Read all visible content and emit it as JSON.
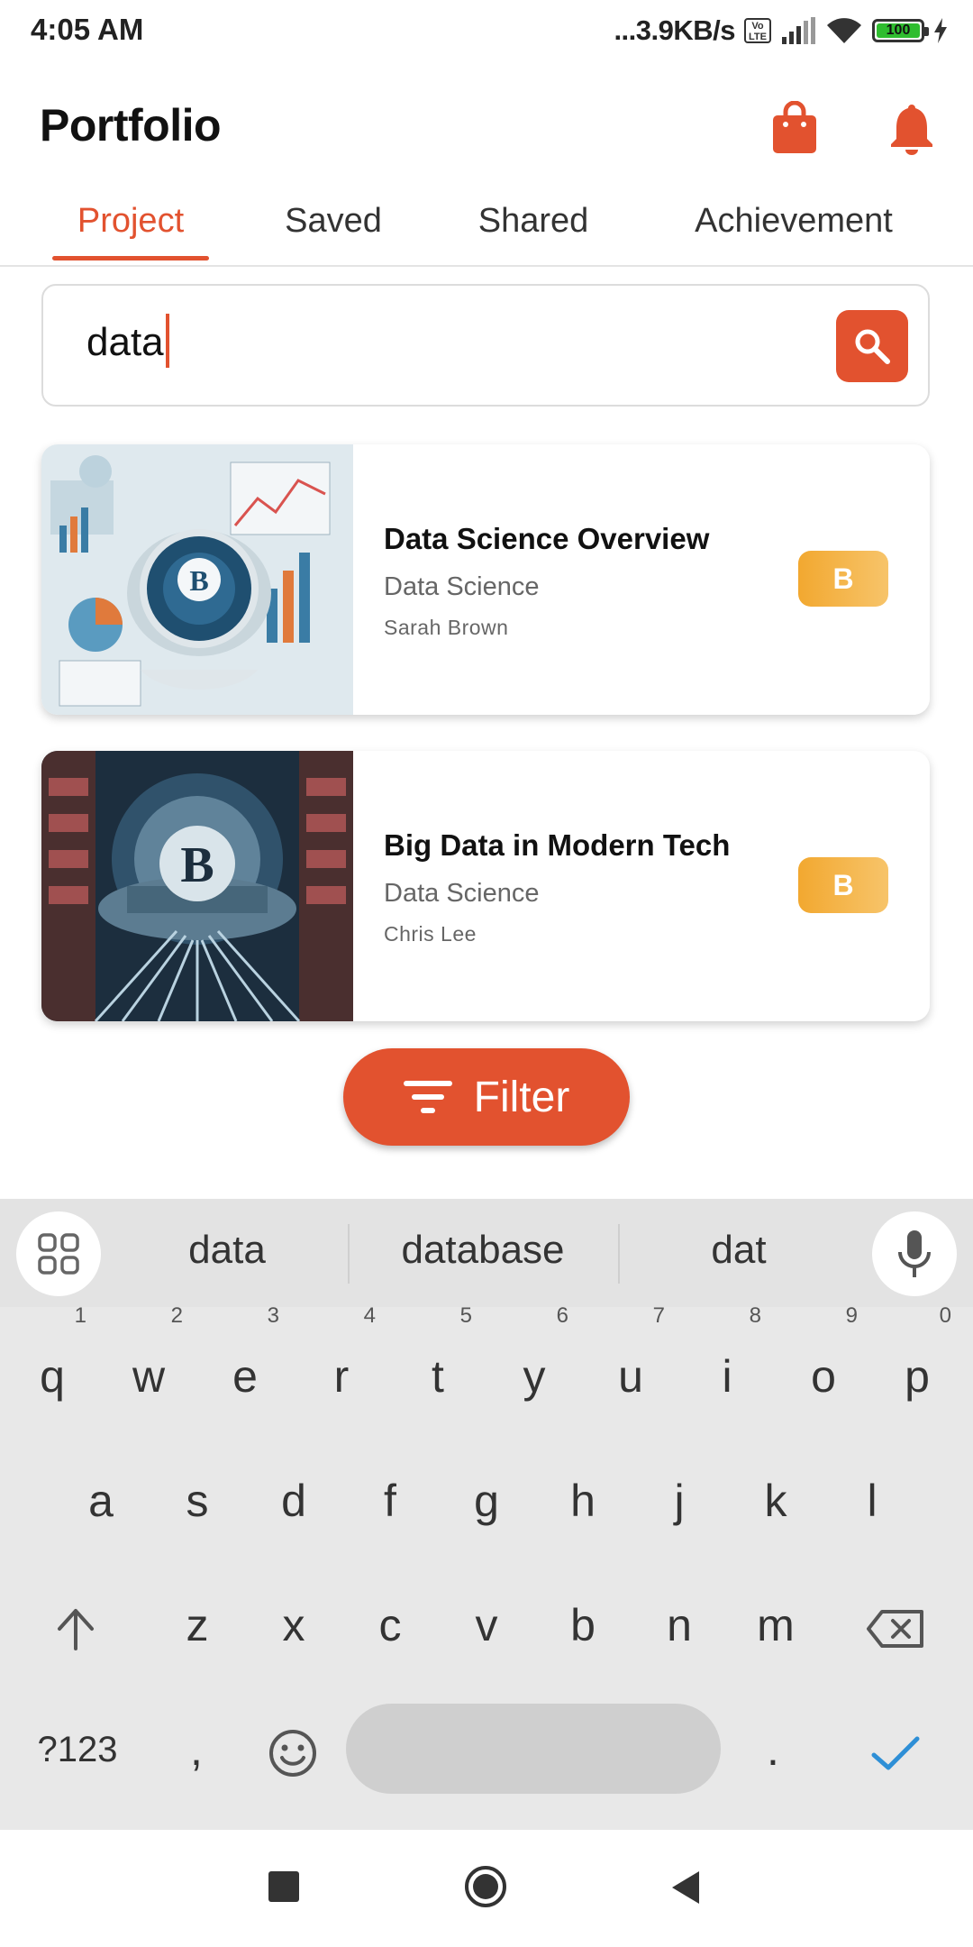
{
  "status_bar": {
    "time": "4:05 AM",
    "network_speed": "...3.9KB/s",
    "volte": "Vo LTE",
    "battery": "100"
  },
  "header": {
    "title": "Portfolio",
    "icons": [
      "shopping-bag-icon",
      "bell-icon"
    ]
  },
  "tabs": [
    {
      "label": "Project",
      "active": true
    },
    {
      "label": "Saved",
      "active": false
    },
    {
      "label": "Shared",
      "active": false
    },
    {
      "label": "Achievement",
      "active": false
    }
  ],
  "search": {
    "value": "data"
  },
  "cards": [
    {
      "title": "Data Science Overview",
      "category": "Data Science",
      "author": "Sarah Brown",
      "badge": "B"
    },
    {
      "title": "Big Data in Modern Tech",
      "category": "Data Science",
      "author": "Chris Lee",
      "badge": "B"
    }
  ],
  "filter": {
    "label": "Filter"
  },
  "keyboard": {
    "suggestions": [
      "data",
      "database",
      "dat"
    ],
    "row1": [
      "q",
      "w",
      "e",
      "r",
      "t",
      "y",
      "u",
      "i",
      "o",
      "p"
    ],
    "row1_numbers": [
      "1",
      "2",
      "3",
      "4",
      "5",
      "6",
      "7",
      "8",
      "9",
      "0"
    ],
    "row2": [
      "a",
      "s",
      "d",
      "f",
      "g",
      "h",
      "j",
      "k",
      "l"
    ],
    "row3": [
      "z",
      "x",
      "c",
      "v",
      "b",
      "n",
      "m"
    ],
    "symbols_key": "?123",
    "comma_key": ",",
    "period_key": "."
  },
  "colors": {
    "accent": "#e2522f",
    "badge": "#f2a830",
    "check": "#2e8fd6"
  }
}
